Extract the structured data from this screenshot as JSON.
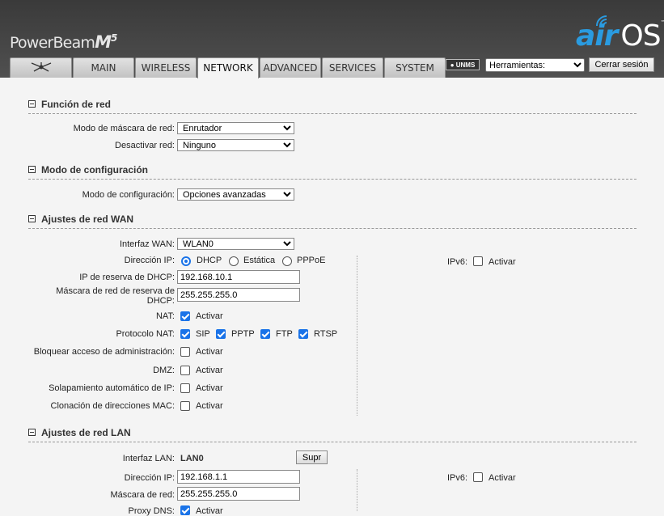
{
  "header": {
    "device_name": "PowerBeam",
    "device_model": "M",
    "device_model_sup": "5",
    "logo_air": "air",
    "logo_os": "OS",
    "logo_tm": "™"
  },
  "tabs": [
    {
      "label": "",
      "icon": "ubiquiti-logo-icon"
    },
    {
      "label": "MAIN"
    },
    {
      "label": "WIRELESS"
    },
    {
      "label": "NETWORK",
      "active": true
    },
    {
      "label": "ADVANCED"
    },
    {
      "label": "SERVICES"
    },
    {
      "label": "SYSTEM"
    }
  ],
  "unms_label": "UNMS",
  "tools": {
    "selected": "Herramientas:"
  },
  "logout_label": "Cerrar sesión",
  "net_function": {
    "title": "Función de red",
    "mask_mode_label": "Modo de máscara de red:",
    "mask_mode_value": "Enrutador",
    "disable_label": "Desactivar red:",
    "disable_value": "Ninguno"
  },
  "config_mode": {
    "title": "Modo de configuración",
    "label": "Modo de configuración:",
    "value": "Opciones avanzadas"
  },
  "wan": {
    "title": "Ajustes de red WAN",
    "iface_label": "Interfaz WAN:",
    "iface_value": "WLAN0",
    "addr_label": "Dirección IP:",
    "addr_options": [
      "DHCP",
      "Estática",
      "PPPoE"
    ],
    "addr_selected": "DHCP",
    "dhcp_fallback_ip_label": "IP de reserva de DHCP:",
    "dhcp_fallback_ip": "192.168.10.1",
    "dhcp_fallback_mask_label_1": "Máscara de red de reserva de",
    "dhcp_fallback_mask_label_2": "DHCP:",
    "dhcp_fallback_mask": "255.255.255.0",
    "nat_label": "NAT:",
    "nat_text": "Activar",
    "nat_protocol_label": "Protocolo NAT:",
    "nat_protocols": [
      "SIP",
      "PPTP",
      "FTP",
      "RTSP"
    ],
    "block_mgmt_label": "Bloquear acceso de administración:",
    "block_mgmt_text": "Activar",
    "dmz_label": "DMZ:",
    "dmz_text": "Activar",
    "ip_alias_label": "Solapamiento automático de IP:",
    "ip_alias_text": "Activar",
    "mac_clone_label": "Clonación de direcciones MAC:",
    "mac_clone_text": "Activar",
    "ipv6_label": "IPv6:",
    "ipv6_text": "Activar"
  },
  "lan": {
    "title": "Ajustes de red LAN",
    "iface_label": "Interfaz LAN:",
    "iface_value": "LAN0",
    "delete_label": "Supr",
    "addr_label": "Dirección IP:",
    "addr_value": "192.168.1.1",
    "mask_label": "Máscara de red:",
    "mask_value": "255.255.255.0",
    "proxy_dns_label": "Proxy DNS:",
    "proxy_dns_text": "Activar",
    "ipv6_label": "IPv6:",
    "ipv6_text": "Activar"
  }
}
